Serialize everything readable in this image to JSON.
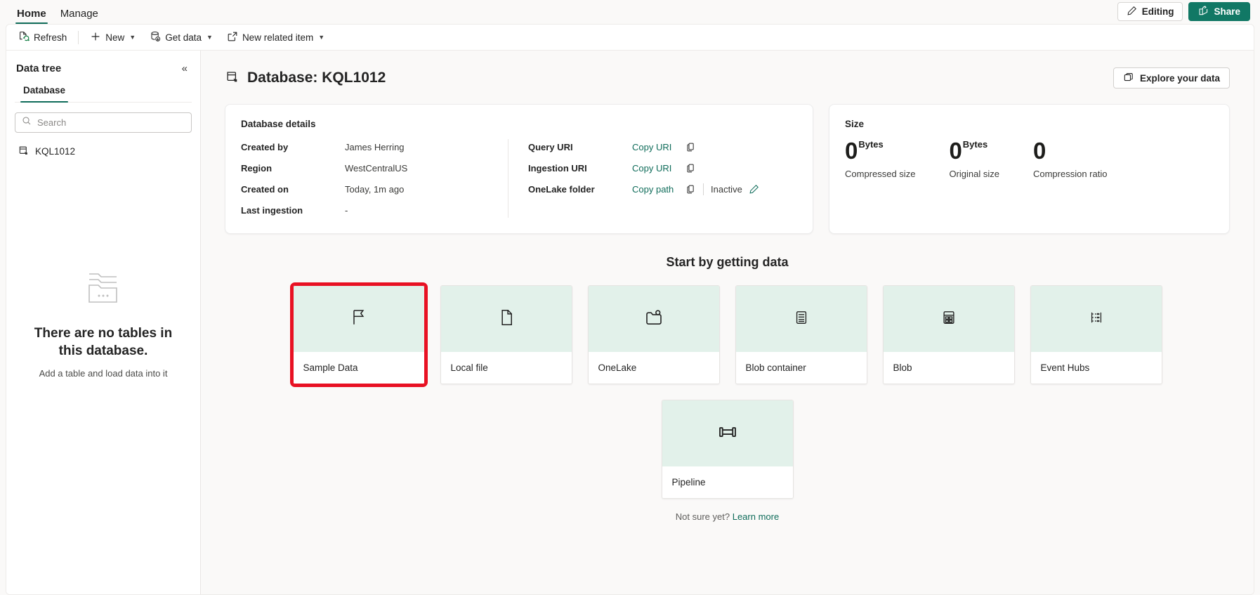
{
  "ribbon": {
    "tabs": [
      {
        "label": "Home",
        "active": true
      },
      {
        "label": "Manage",
        "active": false
      }
    ],
    "editing_label": "Editing",
    "share_label": "Share"
  },
  "commandbar": {
    "items": [
      {
        "label": "Refresh",
        "icon": "refresh-icon",
        "caret": false
      },
      {
        "label": "New",
        "icon": "plus-icon",
        "caret": true
      },
      {
        "label": "Get data",
        "icon": "get-data-icon",
        "caret": true
      },
      {
        "label": "New related item",
        "icon": "external-link-icon",
        "caret": true
      }
    ]
  },
  "sidebar": {
    "title": "Data tree",
    "collapse_glyph": "«",
    "tabs": [
      {
        "label": "Database",
        "active": true
      }
    ],
    "search": {
      "value": "",
      "placeholder": "Search"
    },
    "nodes": [
      {
        "label": "KQL1012",
        "icon": "database-icon"
      }
    ],
    "empty": {
      "title": "There are no tables in this database.",
      "subtitle": "Add a table and load data into it"
    }
  },
  "main": {
    "page_title": "Database: KQL1012",
    "explore_button": "Explore your data",
    "details": {
      "title": "Database details",
      "left_rows": [
        {
          "key": "Created by",
          "value": "James Herring"
        },
        {
          "key": "Region",
          "value": "WestCentralUS"
        },
        {
          "key": "Created on",
          "value": "Today, 1m ago"
        },
        {
          "key": "Last ingestion",
          "value": "-"
        }
      ],
      "right_rows": [
        {
          "key": "Query URI",
          "link": "Copy URI",
          "status": ""
        },
        {
          "key": "Ingestion URI",
          "link": "Copy URI",
          "status": ""
        },
        {
          "key": "OneLake folder",
          "link": "Copy path",
          "status": "Inactive"
        }
      ]
    },
    "size": {
      "title": "Size",
      "metrics": [
        {
          "value": "0",
          "unit": "Bytes",
          "label": "Compressed size"
        },
        {
          "value": "0",
          "unit": "Bytes",
          "label": "Original size"
        },
        {
          "value": "0",
          "unit": "",
          "label": "Compression ratio"
        }
      ]
    },
    "getdata": {
      "title": "Start by getting data",
      "tiles_row1": [
        {
          "label": "Sample Data",
          "icon": "flag-icon",
          "highlighted": true
        },
        {
          "label": "Local file",
          "icon": "document-icon",
          "highlighted": false
        },
        {
          "label": "OneLake",
          "icon": "folder-icon",
          "highlighted": false
        },
        {
          "label": "Blob container",
          "icon": "blob-container-icon",
          "highlighted": false
        },
        {
          "label": "Blob",
          "icon": "blob-icon",
          "highlighted": false
        },
        {
          "label": "Event Hubs",
          "icon": "event-hubs-icon",
          "highlighted": false
        }
      ],
      "tiles_row2": [
        {
          "label": "Pipeline",
          "icon": "pipeline-icon",
          "highlighted": false
        }
      ],
      "footnote_text": "Not sure yet? ",
      "footnote_link": "Learn more"
    }
  },
  "colors": {
    "accent_green": "#0f6c5a",
    "share_green": "#117865",
    "tile_green": "#e2f1ea",
    "highlight_red": "#e81123"
  }
}
